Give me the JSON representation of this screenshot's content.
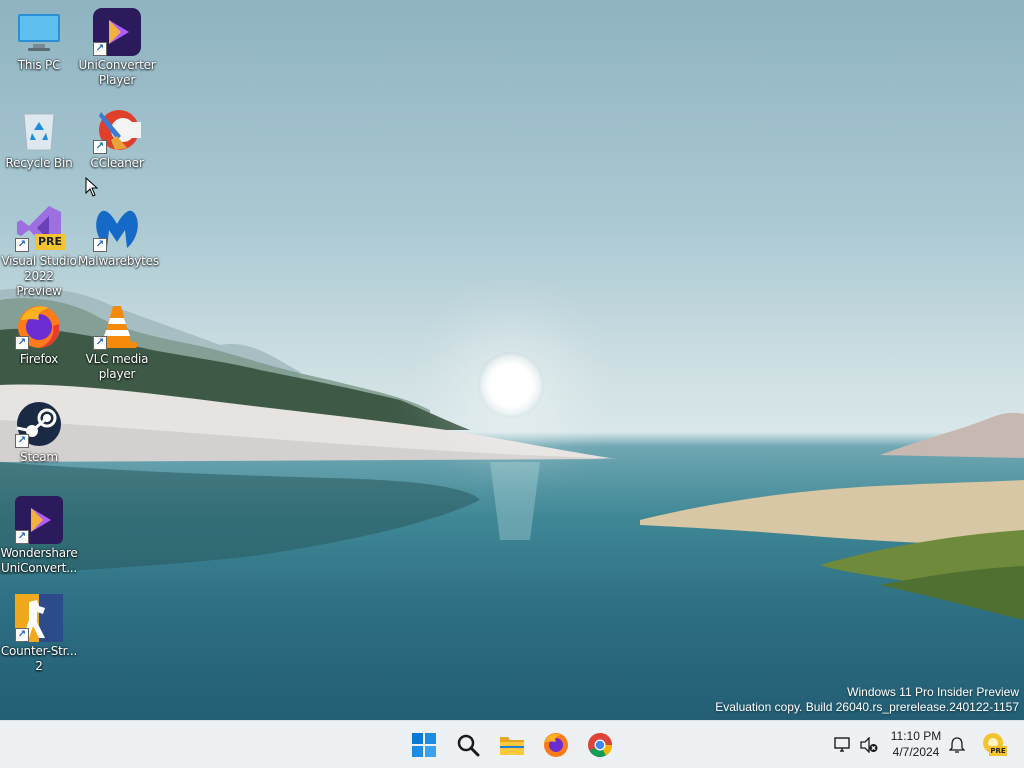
{
  "desktop": {
    "icons": [
      {
        "label": "This PC",
        "icon": "monitor-icon"
      },
      {
        "label": "UniConverter Player",
        "icon": "uniconverter-player-icon"
      },
      {
        "label": "Recycle Bin",
        "icon": "recycle-bin-icon"
      },
      {
        "label": "CCleaner",
        "icon": "ccleaner-icon"
      },
      {
        "label": "Visual Studio 2022 Preview",
        "icon": "visual-studio-icon"
      },
      {
        "label": "Malwarebytes",
        "icon": "malwarebytes-icon"
      },
      {
        "label": "Firefox",
        "icon": "firefox-icon"
      },
      {
        "label": "VLC media player",
        "icon": "vlc-icon"
      },
      {
        "label": "Steam",
        "icon": "steam-icon"
      },
      {
        "label": "Wondershare UniConvert...",
        "icon": "wondershare-uniconverter-icon"
      },
      {
        "label": "Counter-Str... 2",
        "icon": "counter-strike-icon"
      }
    ],
    "pre_badge": "PRE"
  },
  "watermark": {
    "line1": "Windows 11 Pro Insider Preview",
    "line2": "Evaluation copy. Build 26040.rs_prerelease.240122-1157"
  },
  "taskbar": {
    "items": [
      "start-icon",
      "search-icon",
      "file-explorer-icon",
      "firefox-icon",
      "chrome-icon"
    ],
    "tray": {
      "time": "11:10 PM",
      "date": "4/7/2024",
      "pre_badge": "PRE"
    }
  },
  "colors": {
    "taskbar_bg": "#eef1f4",
    "accent": "#0078d4"
  }
}
